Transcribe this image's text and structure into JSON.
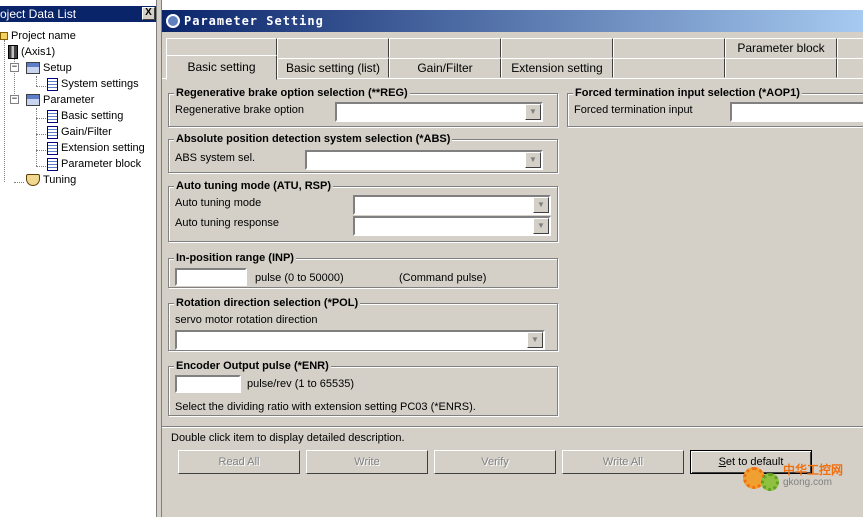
{
  "project_list": {
    "title": "Project Data List",
    "close_label": "X",
    "tree": {
      "project_name": "Project name",
      "axis": "(Axis1)",
      "setup": "Setup",
      "system_settings": "System settings",
      "parameter": "Parameter",
      "basic_setting": "Basic setting",
      "gain_filter": "Gain/Filter",
      "extension_setting": "Extension setting",
      "parameter_block": "Parameter block",
      "tuning": "Tuning"
    },
    "expander_symbol": "−"
  },
  "window": {
    "title": "Parameter Setting",
    "tabs": {
      "basic_setting": "Basic setting",
      "basic_setting_list": "Basic setting (list)",
      "gain_filter": "Gain/Filter",
      "extension_setting": "Extension setting",
      "parameter_block": "Parameter block"
    },
    "active_tab": "Basic setting"
  },
  "groups": {
    "reg": {
      "title": "Regenerative brake option selection (**REG)",
      "label": "Regenerative brake option"
    },
    "abs": {
      "title": "Absolute position detection system selection (*ABS)",
      "label": "ABS system sel."
    },
    "atu": {
      "title": "Auto tuning mode (ATU, RSP)",
      "label_mode": "Auto tuning mode",
      "label_response": "Auto tuning response"
    },
    "inp": {
      "title": "In-position range (INP)",
      "unit": "pulse (0 to 50000)",
      "note": "(Command pulse)"
    },
    "pol": {
      "title": "Rotation direction selection (*POL)",
      "label": "servo motor rotation direction"
    },
    "enr": {
      "title": "Encoder Output pulse (*ENR)",
      "unit": "pulse/rev (1 to 65535)",
      "note": "Select the dividing ratio with extension setting PC03 (*ENRS)."
    },
    "aop1": {
      "title": "Forced termination input selection (*AOP1)",
      "label": "Forced termination input"
    }
  },
  "dropdown_arrow": "▼",
  "status_text": "Double click item to display detailed description.",
  "buttons": {
    "read_all": "Read All",
    "write": "Write",
    "verify": "Verify",
    "write_all": "Write All",
    "set_default_first": "S",
    "set_default_rest": "et to default"
  },
  "watermark": {
    "brand": "中华工控网",
    "url": "gkong.com"
  }
}
